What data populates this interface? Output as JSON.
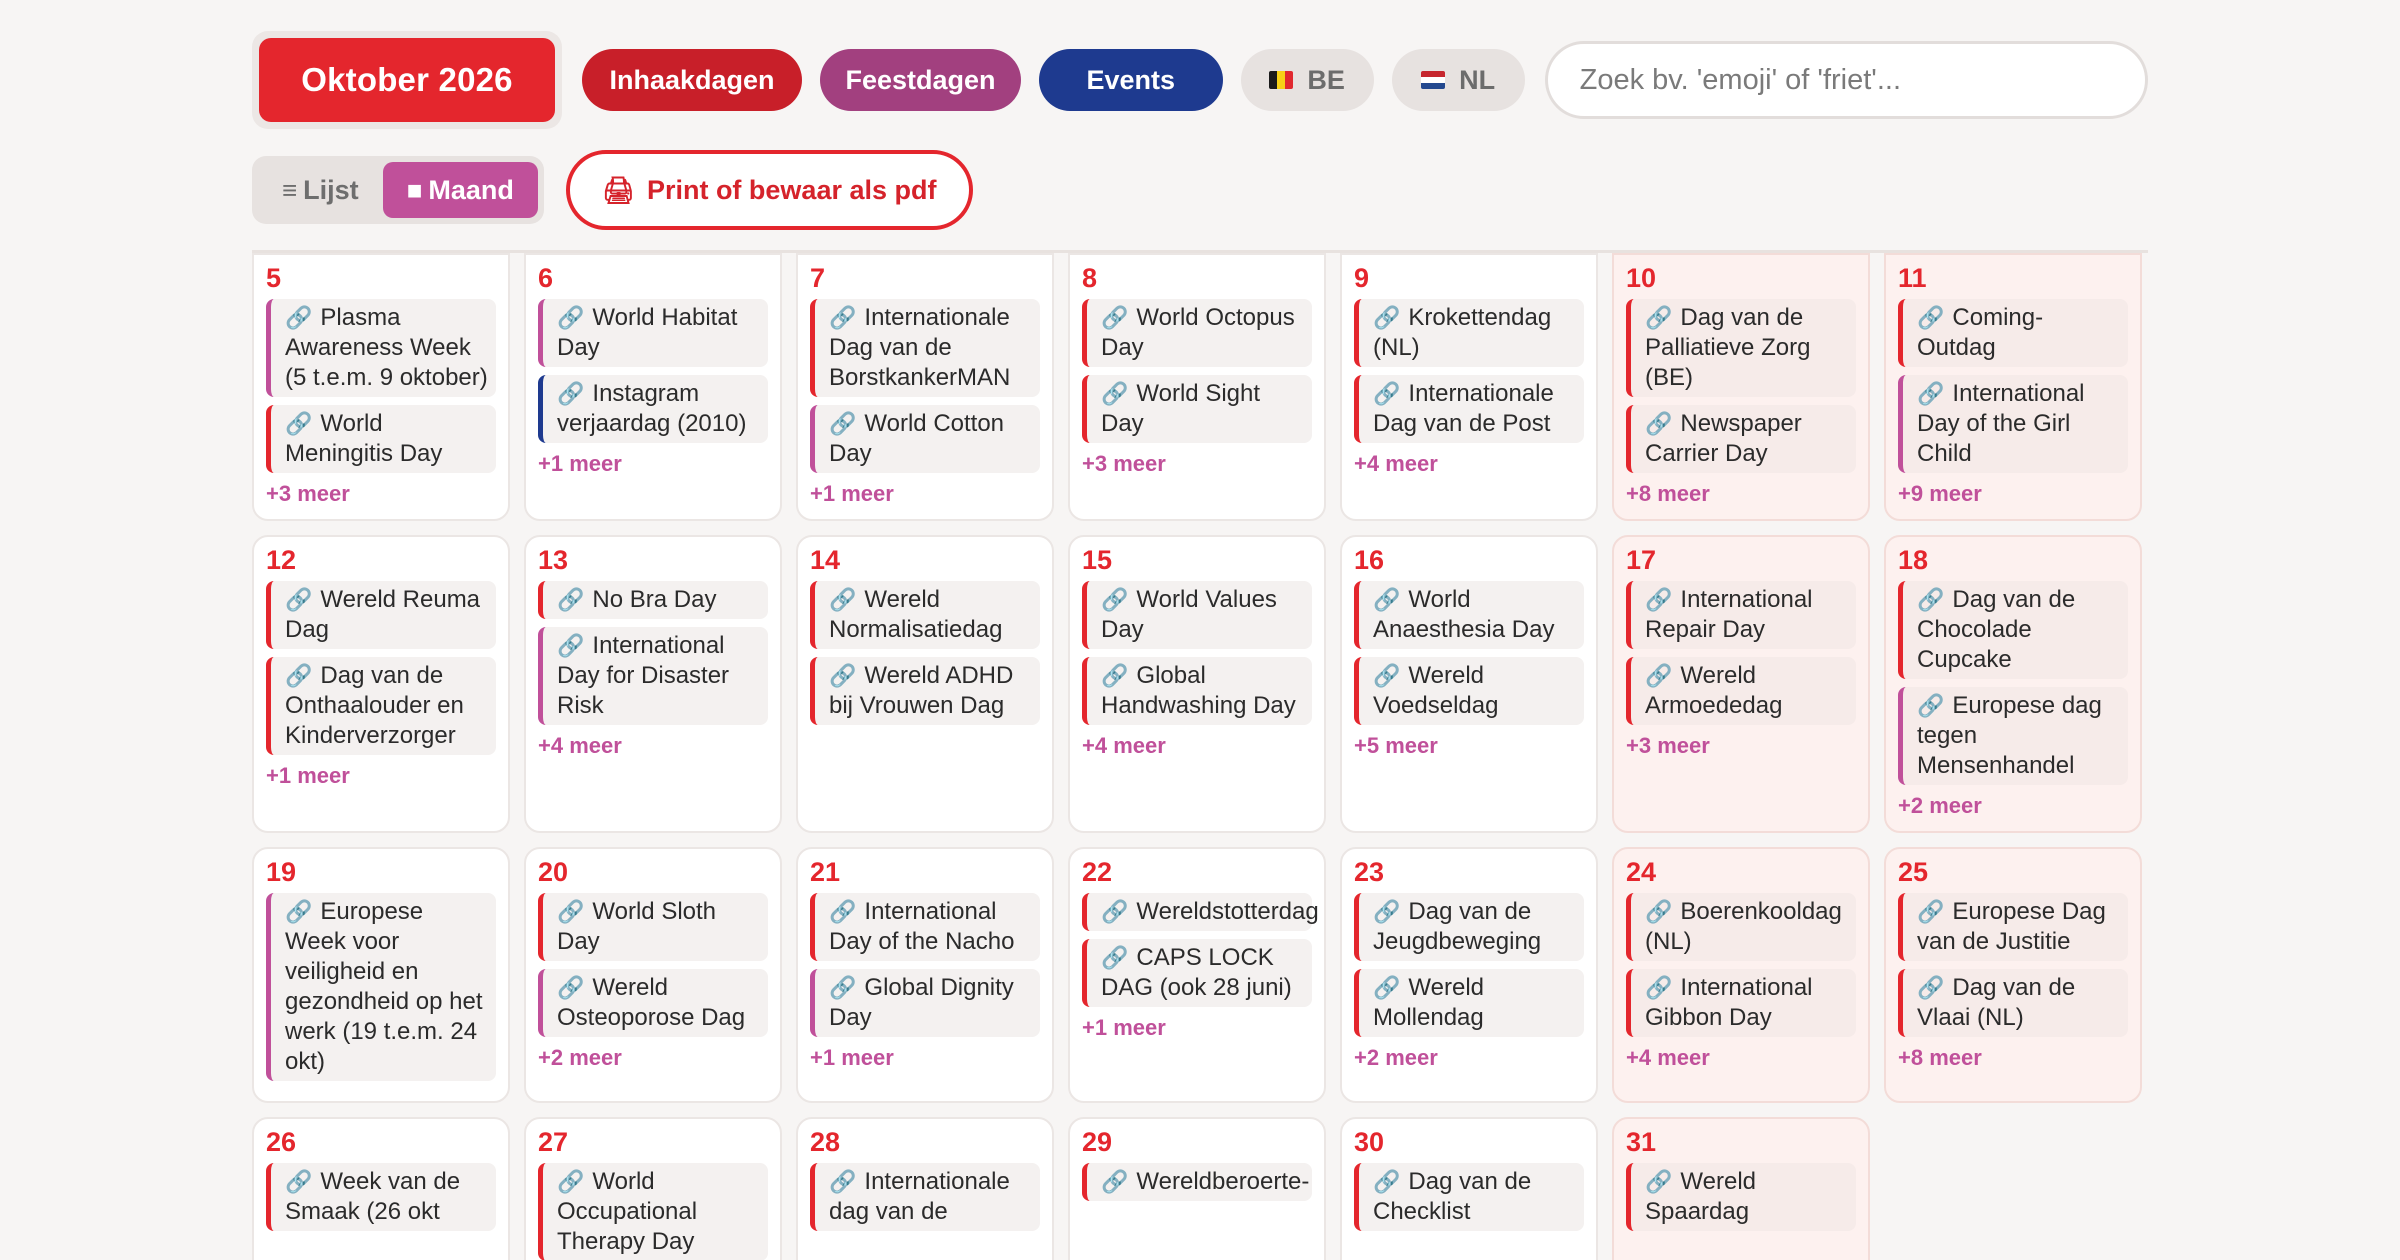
{
  "header": {
    "month_label": "Oktober 2026",
    "filters": [
      "Inhaakdagen",
      "Feestdagen",
      "Events"
    ],
    "country_be": "BE",
    "country_nl": "NL",
    "search_placeholder": "Zoek bv. 'emoji' of 'friet'..."
  },
  "view": {
    "list_icon": "≡",
    "list_label": "Lijst",
    "month_icon": "■",
    "month_label": "Maand",
    "print_icon": "🖨",
    "print_label": "Print of bewaar als pdf"
  },
  "link_icon": "🔗",
  "days": [
    {
      "num": "5",
      "weekend": false,
      "events": [
        {
          "t": "Plasma Awareness Week (5 t.e.m. 9 oktober)",
          "c": "purple"
        },
        {
          "t": "World Meningitis Day",
          "c": "red"
        }
      ],
      "more": "+3 meer"
    },
    {
      "num": "6",
      "weekend": false,
      "events": [
        {
          "t": "World Habitat Day",
          "c": "purple"
        },
        {
          "t": "Instagram verjaardag (2010)",
          "c": "blue"
        }
      ],
      "more": "+1 meer"
    },
    {
      "num": "7",
      "weekend": false,
      "events": [
        {
          "t": "Internationale Dag van de BorstkankerMAN",
          "c": "red"
        },
        {
          "t": "World Cotton Day",
          "c": "purple"
        }
      ],
      "more": "+1 meer"
    },
    {
      "num": "8",
      "weekend": false,
      "events": [
        {
          "t": "World Octopus Day",
          "c": "red"
        },
        {
          "t": "World Sight Day",
          "c": "red"
        }
      ],
      "more": "+3 meer"
    },
    {
      "num": "9",
      "weekend": false,
      "events": [
        {
          "t": "Kroketten­dag (NL)",
          "c": "red"
        },
        {
          "t": "Internationale Dag van de Post",
          "c": "red"
        }
      ],
      "more": "+4 meer"
    },
    {
      "num": "10",
      "weekend": true,
      "events": [
        {
          "t": "Dag van de Palliatieve Zorg (BE)",
          "c": "red"
        },
        {
          "t": "Newspaper Carrier Day",
          "c": "red"
        }
      ],
      "more": "+8 meer"
    },
    {
      "num": "11",
      "weekend": true,
      "events": [
        {
          "t": "Coming-Outdag",
          "c": "red"
        },
        {
          "t": "International Day of the Girl Child",
          "c": "purple"
        }
      ],
      "more": "+9 meer"
    },
    {
      "num": "12",
      "weekend": false,
      "events": [
        {
          "t": "Wereld Reuma Dag",
          "c": "red"
        },
        {
          "t": "Dag van de Onthaalouder en Kinderverzorger",
          "c": "red"
        }
      ],
      "more": "+1 meer"
    },
    {
      "num": "13",
      "weekend": false,
      "events": [
        {
          "t": "No Bra Day",
          "c": "red"
        },
        {
          "t": "International Day for Disaster Risk",
          "c": "purple"
        }
      ],
      "more": "+4 meer"
    },
    {
      "num": "14",
      "weekend": false,
      "events": [
        {
          "t": "Wereld Normalisatiedag",
          "c": "red"
        },
        {
          "t": "Wereld ADHD bij Vrouwen Dag",
          "c": "red"
        }
      ],
      "more": ""
    },
    {
      "num": "15",
      "weekend": false,
      "events": [
        {
          "t": "World Values Day",
          "c": "red"
        },
        {
          "t": "Global Handwashing Day",
          "c": "red"
        }
      ],
      "more": "+4 meer"
    },
    {
      "num": "16",
      "weekend": false,
      "events": [
        {
          "t": "World Anaesthesia Day",
          "c": "red"
        },
        {
          "t": "Wereld Voedseldag",
          "c": "red"
        }
      ],
      "more": "+5 meer"
    },
    {
      "num": "17",
      "weekend": true,
      "events": [
        {
          "t": "International Repair Day",
          "c": "red"
        },
        {
          "t": "Wereld Armoededag",
          "c": "red"
        }
      ],
      "more": "+3 meer"
    },
    {
      "num": "18",
      "weekend": true,
      "events": [
        {
          "t": "Dag van de Chocolade Cupcake",
          "c": "red"
        },
        {
          "t": "Europese dag tegen Mensenhandel",
          "c": "purple"
        }
      ],
      "more": "+2 meer"
    },
    {
      "num": "19",
      "weekend": false,
      "events": [
        {
          "t": "Europese Week voor veiligheid en gezondheid op het werk (19 t.e.m. 24 okt)",
          "c": "purple"
        }
      ],
      "more": ""
    },
    {
      "num": "20",
      "weekend": false,
      "events": [
        {
          "t": "World Sloth Day",
          "c": "red"
        },
        {
          "t": "Wereld Osteoporose Dag",
          "c": "purple"
        }
      ],
      "more": "+2 meer"
    },
    {
      "num": "21",
      "weekend": false,
      "events": [
        {
          "t": "International Day of the Nacho",
          "c": "red"
        },
        {
          "t": "Global Dignity Day",
          "c": "purple"
        }
      ],
      "more": "+1 meer"
    },
    {
      "num": "22",
      "weekend": false,
      "events": [
        {
          "t": "Wereldstotterdag",
          "c": "red"
        },
        {
          "t": "CAPS LOCK DAG (ook 28 juni)",
          "c": "red"
        }
      ],
      "more": "+1 meer"
    },
    {
      "num": "23",
      "weekend": false,
      "events": [
        {
          "t": "Dag van de Jeugdbeweging",
          "c": "red"
        },
        {
          "t": "Wereld Mollendag",
          "c": "red"
        }
      ],
      "more": "+2 meer"
    },
    {
      "num": "24",
      "weekend": true,
      "events": [
        {
          "t": "Boerenkooldag (NL)",
          "c": "red"
        },
        {
          "t": "International Gibbon Day",
          "c": "red"
        }
      ],
      "more": "+4 meer"
    },
    {
      "num": "25",
      "weekend": true,
      "events": [
        {
          "t": "Europese Dag van de Justitie",
          "c": "red"
        },
        {
          "t": "Dag van de Vlaai (NL)",
          "c": "red"
        }
      ],
      "more": "+8 meer"
    },
    {
      "num": "26",
      "weekend": false,
      "events": [
        {
          "t": "Week van de Smaak (26 okt",
          "c": "red"
        }
      ],
      "more": ""
    },
    {
      "num": "27",
      "weekend": false,
      "events": [
        {
          "t": "World Occupational Therapy Day",
          "c": "red"
        }
      ],
      "more": ""
    },
    {
      "num": "28",
      "weekend": false,
      "events": [
        {
          "t": "Internationale dag van de",
          "c": "red"
        }
      ],
      "more": ""
    },
    {
      "num": "29",
      "weekend": false,
      "events": [
        {
          "t": "Wereldberoerte-",
          "c": "red"
        }
      ],
      "more": ""
    },
    {
      "num": "30",
      "weekend": false,
      "events": [
        {
          "t": "Dag van de Checklist",
          "c": "red"
        }
      ],
      "more": ""
    },
    {
      "num": "31",
      "weekend": true,
      "events": [
        {
          "t": "Wereld Spaardag",
          "c": "red"
        }
      ],
      "more": ""
    }
  ]
}
